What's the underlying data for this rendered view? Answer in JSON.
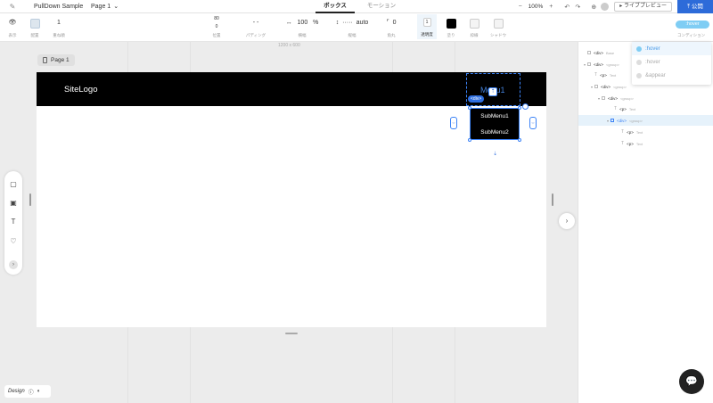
{
  "topbar": {
    "project_name": "PullDown Sample",
    "page_selector": "Page 1",
    "tabs": [
      {
        "label": "ボックス"
      },
      {
        "label": "モーション"
      }
    ],
    "zoom": "100%",
    "live_preview": "ライブプレビュー",
    "publish": "公開"
  },
  "toolbar": {
    "visibility_label": "表示",
    "layout_label": "配置",
    "order_value": "1",
    "order_label": "重ね順",
    "position_value": "80",
    "position_value2": "0",
    "position_label": "位置",
    "padding_label": "パディング",
    "width_value": "100",
    "width_unit": "%",
    "width_label": "横幅",
    "height_value": "auto",
    "height_label": "縦幅",
    "radius_value": "0",
    "radius_label": "角丸",
    "opacity_value": "1",
    "opacity_label": "透明度",
    "fill_label": "塗り",
    "border_label": "枠線",
    "shadow_label": "シャドウ",
    "hover_chip": ":hover",
    "condition_label": "コンディション"
  },
  "canvas": {
    "ruler_label": "1200 x 600",
    "page_label": "Page 1",
    "site_logo": "SiteLogo",
    "menu_text": "Menu1",
    "div_badge": "<div>",
    "submenu_items": [
      "SubMenu1",
      "SubMenu2"
    ]
  },
  "layers": [
    {
      "tag": "<div>",
      "sub": "Base"
    },
    {
      "tag": "<div>",
      "sub": "<group>"
    },
    {
      "tag": "<p>",
      "sub": "Text"
    },
    {
      "tag": "<div>",
      "sub": "<group>"
    },
    {
      "tag": "<div>",
      "sub": "<group>"
    },
    {
      "tag": "<p>",
      "sub": "Text"
    },
    {
      "tag": "<div>",
      "sub": "<group>"
    },
    {
      "tag": "<p>",
      "sub": "Text"
    },
    {
      "tag": "<p>",
      "sub": "Text"
    }
  ],
  "condition_menu": [
    ":hover",
    ":hover",
    "&appear"
  ],
  "bottom": {
    "design_label": "Design"
  },
  "colors": {
    "accent": "#2d6bd9",
    "hover_chip": "#7fcdf4",
    "selection": "#3b82f6"
  }
}
